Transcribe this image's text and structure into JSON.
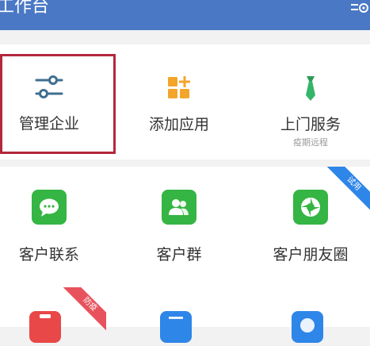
{
  "header": {
    "title": "工作台"
  },
  "top_section": {
    "items": [
      {
        "label": "管理企业",
        "icon": "sliders-icon"
      },
      {
        "label": "添加应用",
        "icon": "add-app-icon"
      },
      {
        "label": "上门服务",
        "sublabel": "疫期远程",
        "icon": "tie-icon"
      }
    ]
  },
  "apps": {
    "items": [
      {
        "label": "客户联系",
        "icon": "chat-bubble-icon",
        "color": "#35b543"
      },
      {
        "label": "客户群",
        "icon": "group-icon",
        "color": "#35b543"
      },
      {
        "label": "客户朋友圈",
        "icon": "aperture-icon",
        "color": "#35b543",
        "badge": "试用"
      }
    ],
    "bottom_badge": "防疫"
  },
  "colors": {
    "header": "#4a78c5",
    "selection": "#b3273c",
    "accent_green": "#35b543",
    "accent_blue": "#2e86e8",
    "accent_orange": "#f3a52a"
  }
}
